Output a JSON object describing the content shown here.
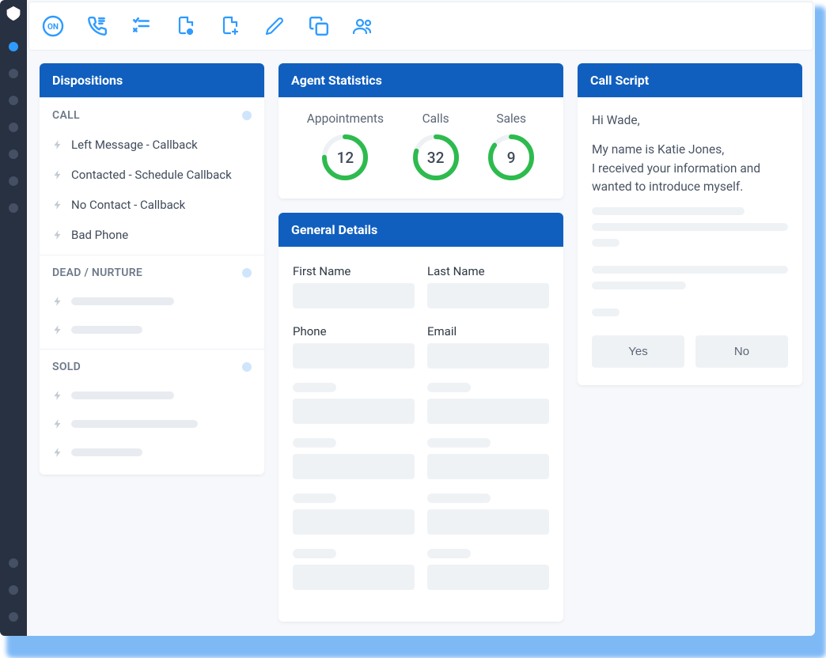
{
  "toolbar_icons": [
    "on",
    "phone",
    "checklist",
    "doc-view",
    "doc-add",
    "pencil",
    "copy",
    "group"
  ],
  "dispositions": {
    "title": "Dispositions",
    "sections": [
      {
        "name": "CALL",
        "items": [
          "Left Message - Callback",
          "Contacted - Schedule Callback",
          "No Contact - Callback",
          "Bad Phone"
        ]
      },
      {
        "name": "DEAD / NURTURE",
        "items_count": 2
      },
      {
        "name": "SOLD",
        "items_count": 3
      }
    ]
  },
  "statistics": {
    "title": "Agent Statistics",
    "items": [
      {
        "label": "Appointments",
        "value": "12",
        "pct": 0.75
      },
      {
        "label": "Calls",
        "value": "32",
        "pct": 0.8
      },
      {
        "label": "Sales",
        "value": "9",
        "pct": 0.85
      }
    ]
  },
  "details": {
    "title": "General Details",
    "fields": {
      "first_name": "First Name",
      "last_name": "Last Name",
      "phone": "Phone",
      "email": "Email"
    }
  },
  "script": {
    "title": "Call Script",
    "line1": "Hi Wade,",
    "line2": "My name is Katie Jones,",
    "line3": "I received your information and wanted to introduce myself.",
    "yes": "Yes",
    "no": "No"
  }
}
